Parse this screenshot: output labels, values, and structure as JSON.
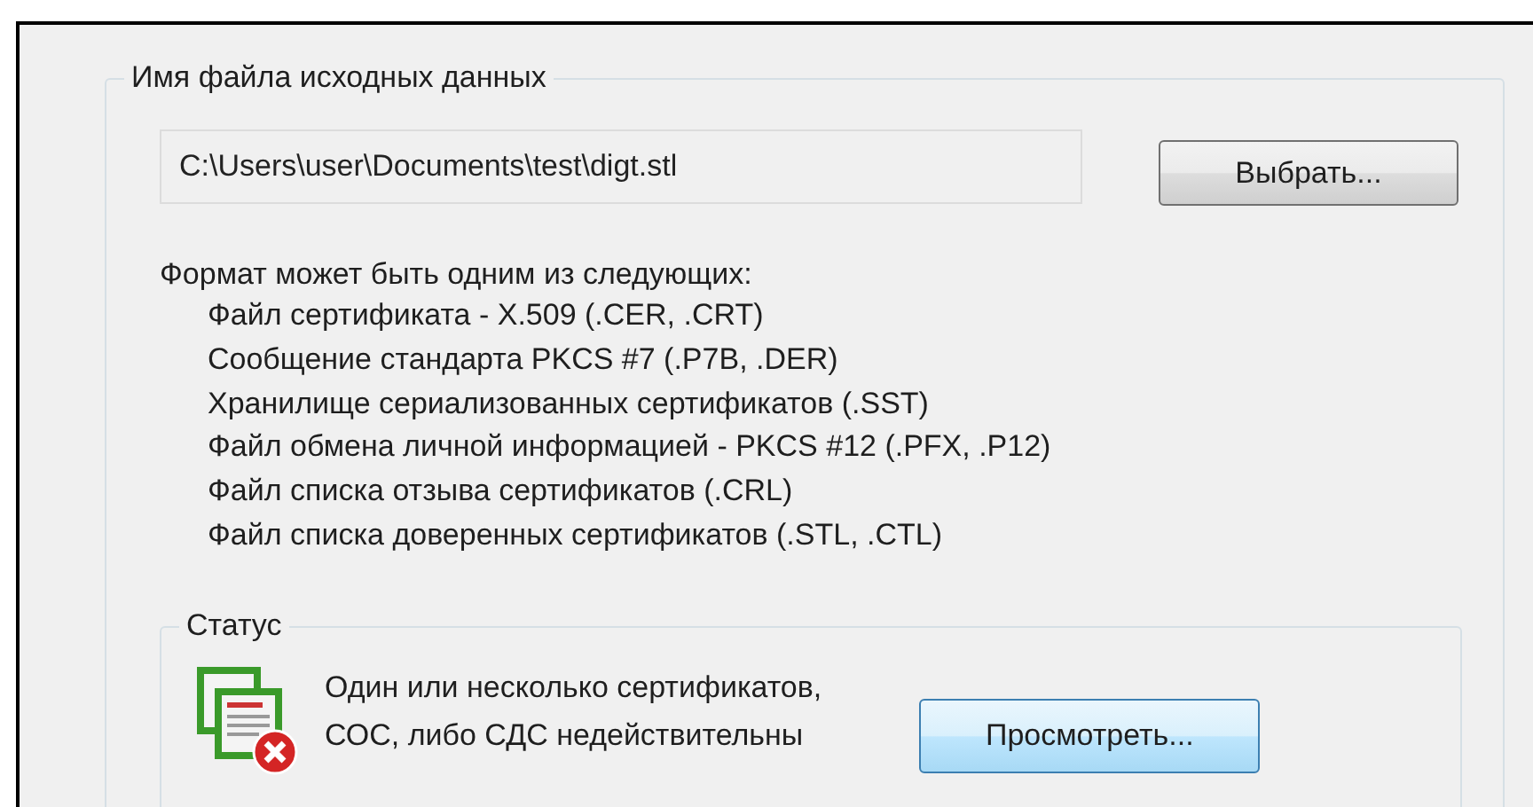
{
  "source_group": {
    "title": "Имя файла исходных данных",
    "file_path": "C:\\Users\\user\\Documents\\test\\digt.stl",
    "browse_button": "Выбрать...",
    "format_intro": "Формат может быть одним из следующих:",
    "formats": [
      "Файл сертификата - X.509 (.CER, .CRT)",
      "Сообщение стандарта PKCS #7 (.P7B, .DER)",
      "Хранилище сериализованных сертификатов (.SST)",
      "Файл обмена личной информацией - PKCS #12 (.PFX, .P12)",
      "Файл списка отзыва сертификатов (.CRL)",
      "Файл списка доверенных сертификатов (.STL, .CTL)"
    ]
  },
  "status_group": {
    "title": "Статус",
    "message_lines": [
      "Один или несколько сертификатов,",
      "СОС, либо СДС недействительны"
    ],
    "view_button": "Просмотреть...",
    "valid": false
  }
}
